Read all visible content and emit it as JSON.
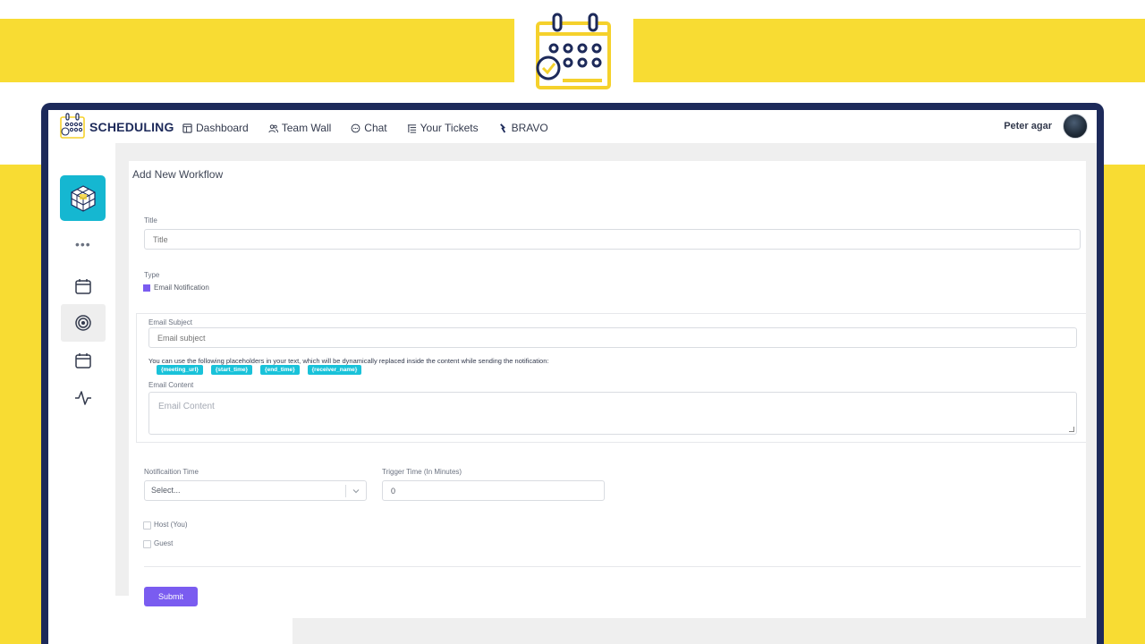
{
  "app": {
    "brand": "SCHEDULING",
    "nav": [
      {
        "label": "Dashboard",
        "icon": "dashboard-icon"
      },
      {
        "label": "Team Wall",
        "icon": "users-icon"
      },
      {
        "label": "Chat",
        "icon": "chat-icon"
      },
      {
        "label": "Your Tickets",
        "icon": "list-icon"
      },
      {
        "label": "BRAVO",
        "icon": "bravo-icon"
      }
    ],
    "user_name": "Peter agar"
  },
  "sidebar": {
    "dots": "•••",
    "items": [
      "calendar-icon",
      "target-icon",
      "calendar-icon",
      "activity-icon"
    ],
    "active_index": 1
  },
  "form": {
    "title": "Add New Workflow",
    "title_field": {
      "label": "Title",
      "placeholder": "Title"
    },
    "type": {
      "label": "Type",
      "value": "Email Notification"
    },
    "email_subject": {
      "label": "Email Subject",
      "placeholder": "Email subject"
    },
    "help_text": "You can use the following placeholders in your text, which will be dynamically replaced inside the content while sending the notification:",
    "placeholders": [
      "{meeting_url}",
      "{start_time}",
      "{end_time}",
      "{receiver_name}"
    ],
    "email_content": {
      "label": "Email Content",
      "placeholder": "Email Content"
    },
    "notification_time": {
      "label": "Notificaition Time",
      "value": "Select..."
    },
    "trigger_time": {
      "label": "Trigger Time (In Minutes)",
      "value": "0"
    },
    "recipients": [
      {
        "label": "Host (You)",
        "checked": false
      },
      {
        "label": "Guest",
        "checked": false
      }
    ],
    "submit_label": "Submit"
  },
  "colors": {
    "background_yellow": "#f8dc33",
    "navy": "#1d2a5a",
    "accent_purple": "#7a5cf0",
    "chip_cyan": "#19c2d9"
  }
}
